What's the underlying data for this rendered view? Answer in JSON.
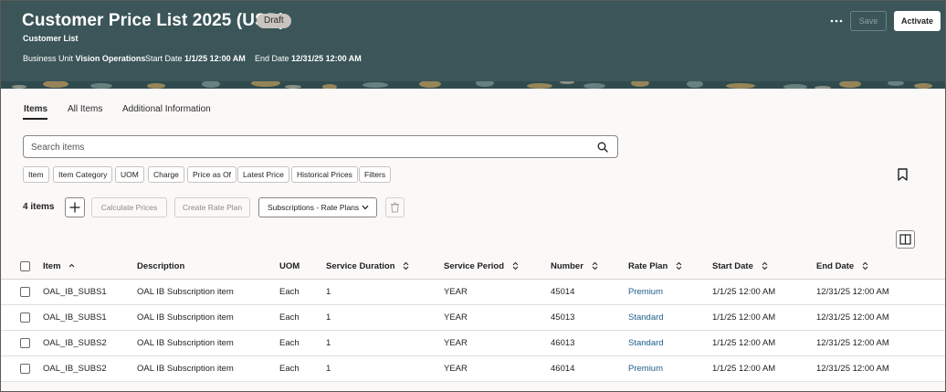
{
  "header": {
    "title": "Customer Price List 2025 (USD)",
    "badge": "Draft",
    "subtitle": "Customer List",
    "business_unit_label": "Business Unit",
    "business_unit_value": "Vision Operations",
    "start_date_label": "Start Date",
    "start_date_value": "1/1/25 12:00 AM",
    "end_date_label": "End Date",
    "end_date_value": "12/31/25 12:00 AM",
    "more_icon": "more-horizontal-icon",
    "save_label": "Save",
    "activate_label": "Activate"
  },
  "tabs": [
    {
      "label": "Items",
      "active": true
    },
    {
      "label": "All Items",
      "active": false
    },
    {
      "label": "Additional Information",
      "active": false
    }
  ],
  "search": {
    "placeholder": "Search items",
    "value": ""
  },
  "filter_chips": [
    "Item",
    "Item Category",
    "UOM",
    "Charge",
    "Price as Of",
    "Latest Price",
    "Historical Prices",
    "Filters"
  ],
  "toolbar": {
    "count_label": "4 items",
    "calculate_prices_label": "Calculate Prices",
    "create_rate_plan_label": "Create Rate Plan",
    "view_select_value": "Subscriptions - Rate Plans"
  },
  "table": {
    "columns": [
      "Item",
      "Description",
      "UOM",
      "Service Duration",
      "Service Period",
      "Number",
      "Rate Plan",
      "Start Date",
      "End Date"
    ],
    "rows": [
      [
        "OAL_IB_SUBS1",
        "OAL IB Subscription item",
        "Each",
        "1",
        "YEAR",
        "45014",
        "Premium",
        "1/1/25 12:00 AM",
        "12/31/25 12:00 AM"
      ],
      [
        "OAL_IB_SUBS1",
        "OAL IB Subscription item",
        "Each",
        "1",
        "YEAR",
        "45013",
        "Standard",
        "1/1/25 12:00 AM",
        "12/31/25 12:00 AM"
      ],
      [
        "OAL_IB_SUBS2",
        "OAL IB Subscription item",
        "Each",
        "1",
        "YEAR",
        "46013",
        "Standard",
        "1/1/25 12:00 AM",
        "12/31/25 12:00 AM"
      ],
      [
        "OAL_IB_SUBS2",
        "OAL IB Subscription item",
        "Each",
        "1",
        "YEAR",
        "46014",
        "Premium",
        "1/1/25 12:00 AM",
        "12/31/25 12:00 AM"
      ]
    ]
  },
  "colors": {
    "header_bg": "#3b5558",
    "link": "#1d5e8a",
    "page_bg": "#fbf9f8"
  }
}
